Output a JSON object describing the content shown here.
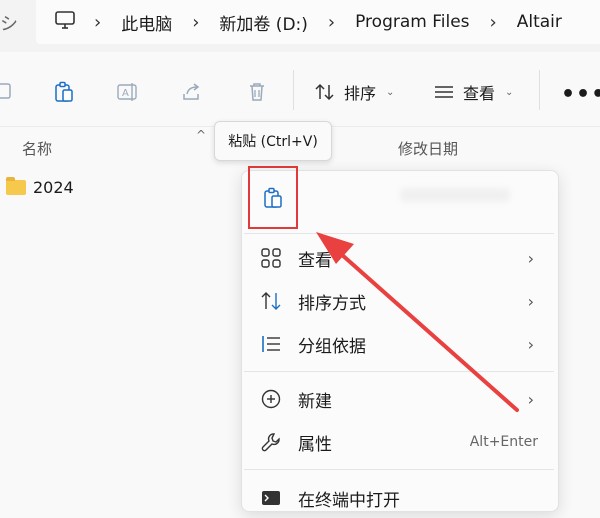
{
  "address": {
    "left_fragment": "シ",
    "crumbs": [
      "此电脑",
      "新加卷 (D:)",
      "Program Files",
      "Altair"
    ]
  },
  "toolbar": {
    "sort_label": "排序",
    "view_label": "查看",
    "more_label": "•••"
  },
  "columns": {
    "name": "名称",
    "modified": "修改日期"
  },
  "files": [
    {
      "name": "2024",
      "type": "folder"
    }
  ],
  "tooltip": {
    "text": "粘贴 (Ctrl+V)"
  },
  "context_menu": {
    "items": [
      {
        "label": "查看",
        "icon": "view-icon",
        "submenu": true
      },
      {
        "label": "排序方式",
        "icon": "sort-icon",
        "submenu": true
      },
      {
        "label": "分组依据",
        "icon": "group-icon",
        "submenu": true
      },
      {
        "label": "新建",
        "icon": "new-icon",
        "submenu": true
      },
      {
        "label": "属性",
        "icon": "properties-icon",
        "shortcut": "Alt+Enter"
      },
      {
        "label": "在终端中打开",
        "icon": "terminal-icon"
      }
    ]
  },
  "colors": {
    "highlight": "#e03a3a",
    "arrow": "#e8413f",
    "folder": "#f6c94c"
  }
}
